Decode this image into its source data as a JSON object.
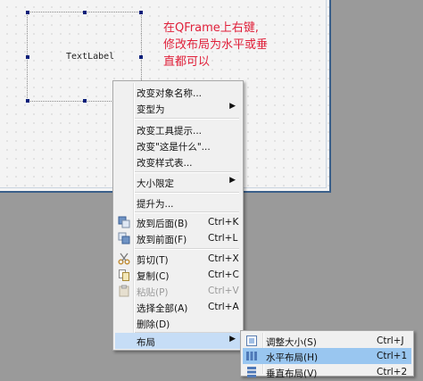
{
  "annotation": "在QFrame上右键,\n修改布局为水平或垂\n直都可以",
  "canvas": {
    "label_text": "TextLabel"
  },
  "context_menu": {
    "items": [
      {
        "label": "改变对象名称...",
        "shortcut": "",
        "submenu": false,
        "disabled": false
      },
      {
        "label": "变型为",
        "shortcut": "",
        "submenu": true,
        "disabled": false
      },
      {
        "label": "改变工具提示...",
        "shortcut": "",
        "submenu": false,
        "disabled": false
      },
      {
        "label": "改变\"这是什么\"...",
        "shortcut": "",
        "submenu": false,
        "disabled": false
      },
      {
        "label": "改变样式表...",
        "shortcut": "",
        "submenu": false,
        "disabled": false
      },
      {
        "label": "大小限定",
        "shortcut": "",
        "submenu": true,
        "disabled": false
      },
      {
        "label": "提升为...",
        "shortcut": "",
        "submenu": false,
        "disabled": false
      },
      {
        "label": "放到后面(B)",
        "shortcut": "Ctrl+K",
        "icon": "send-to-back-icon",
        "disabled": false
      },
      {
        "label": "放到前面(F)",
        "shortcut": "Ctrl+L",
        "icon": "bring-to-front-icon",
        "disabled": false
      },
      {
        "label": "剪切(T)",
        "shortcut": "Ctrl+X",
        "icon": "scissors-icon",
        "disabled": false
      },
      {
        "label": "复制(C)",
        "shortcut": "Ctrl+C",
        "icon": "copy-icon",
        "disabled": false
      },
      {
        "label": "粘贴(P)",
        "shortcut": "Ctrl+V",
        "icon": "paste-icon",
        "disabled": true
      },
      {
        "label": "选择全部(A)",
        "shortcut": "Ctrl+A",
        "disabled": false
      },
      {
        "label": "删除(D)",
        "shortcut": "",
        "disabled": false
      },
      {
        "label": "布局",
        "shortcut": "",
        "submenu": true,
        "disabled": false
      }
    ]
  },
  "layout_submenu": {
    "items": [
      {
        "label": "调整大小(S)",
        "shortcut": "Ctrl+J",
        "icon": "adjust-size-icon"
      },
      {
        "label": "水平布局(H)",
        "shortcut": "Ctrl+1",
        "icon": "horizontal-layout-icon"
      },
      {
        "label": "垂直布局(V)",
        "shortcut": "Ctrl+2",
        "icon": "vertical-layout-icon"
      }
    ]
  },
  "colors": {
    "annotation": "#e0203a",
    "selection_handle": "#0a1f7a",
    "menu_highlight": "#c6ddf6",
    "submenu_highlight": "#99c6f0"
  }
}
